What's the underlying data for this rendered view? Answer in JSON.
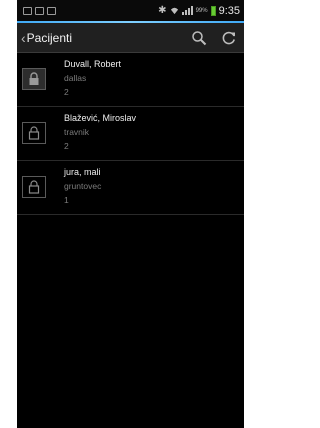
{
  "status_bar": {
    "battery_pct": "99%",
    "time": "9:35",
    "icons": [
      "mail-icon",
      "screen-mirror-icon",
      "image-icon",
      "bluetooth-icon",
      "wifi-icon",
      "signal-icon",
      "battery-icon"
    ]
  },
  "header": {
    "title": "Pacijenti",
    "back_icon": "chevron-left-icon",
    "actions": [
      "search-icon",
      "refresh-icon"
    ]
  },
  "patients": [
    {
      "name": "Duvall, Robert",
      "city": "dallas",
      "count": "2",
      "avatar": "lock-icon"
    },
    {
      "name": "Blažević, Miroslav",
      "city": "travnik",
      "count": "2",
      "avatar": "lock-icon"
    },
    {
      "name": "jura, mali",
      "city": "gruntovec",
      "count": "1",
      "avatar": "lock-icon"
    }
  ],
  "colors": {
    "accent": "#3fa9f5",
    "battery": "#66cc33",
    "background": "#000000",
    "action_bar": "#202020",
    "secondary_text": "#7c7c7c"
  }
}
